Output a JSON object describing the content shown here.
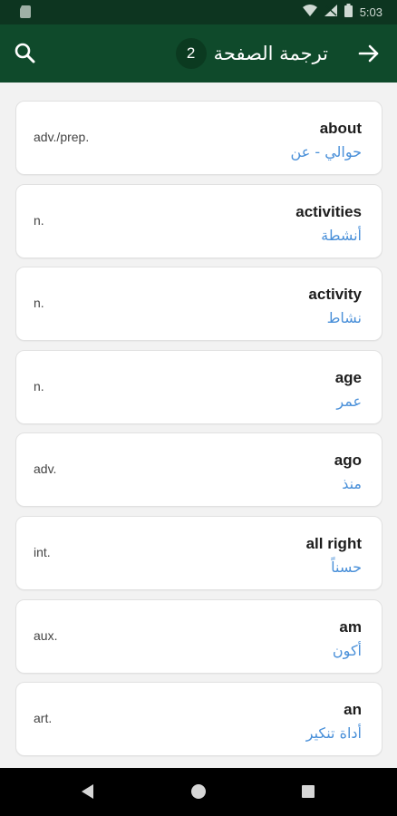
{
  "status_bar": {
    "time": "5:03"
  },
  "app_bar": {
    "title": "ترجمة الصفحة",
    "page_number": "2",
    "search_icon": "search-icon",
    "back_icon": "arrow-right-icon"
  },
  "words": [
    {
      "term": "about",
      "pos": "adv./prep.",
      "translation": "حوالي - عن"
    },
    {
      "term": "activities",
      "pos": "n.",
      "translation": "أنشطة"
    },
    {
      "term": "activity",
      "pos": "n.",
      "translation": "نشاط"
    },
    {
      "term": "age",
      "pos": "n.",
      "translation": "عمر"
    },
    {
      "term": "ago",
      "pos": "adv.",
      "translation": "منذ"
    },
    {
      "term": "all right",
      "pos": "int.",
      "translation": "حسناً"
    },
    {
      "term": "am",
      "pos": "aux.",
      "translation": "أكون"
    },
    {
      "term": "an",
      "pos": "art.",
      "translation": "أداة تنكير"
    }
  ],
  "colors": {
    "app_bar": "#0f4a2b",
    "status_bar": "#0d3520",
    "translation_text": "#4a90d9"
  }
}
